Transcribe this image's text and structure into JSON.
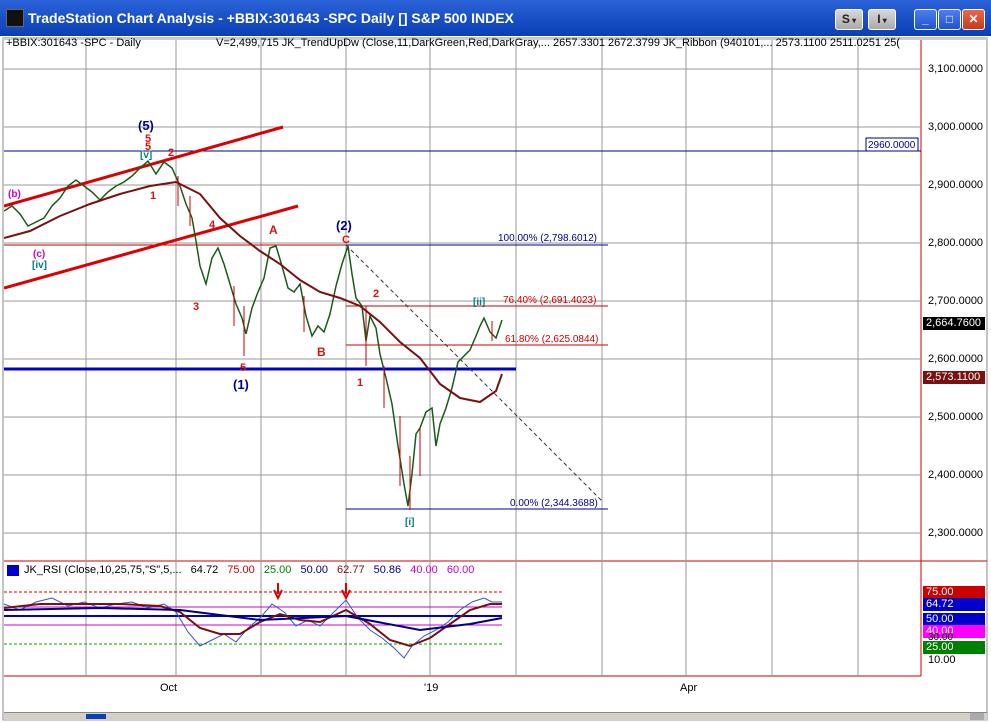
{
  "window": {
    "title": "TradeStation Chart Analysis - +BBIX:301643 -SPC Daily [] S&P 500 INDEX",
    "btn_s": "S",
    "btn_i": "I"
  },
  "header": {
    "symbol": "+BBIX:301643 -SPC - Daily",
    "indicator_line": "V=2,499,715  JK_TrendUpDw (Close,11,DarkGreen,Red,DarkGray,...   2657.3301   2672.3799  JK_Ribbon (940101,...   2573.1100   2511.0251   25("
  },
  "price_axis": {
    "ticks": [
      "3,100.0000",
      "3,000.0000",
      "2,900.0000",
      "2,800.0000",
      "2,700.0000",
      "2,600.0000",
      "2,500.0000",
      "2,400.0000",
      "2,300.0000"
    ]
  },
  "price_boxes": {
    "last": "2,664.7600",
    "ribbon": "2,573.1100"
  },
  "levels": {
    "resistance": "2960.0000"
  },
  "fib": {
    "f100": "100.00% (2,798.6012)",
    "f764": "76.40% (2,691.4023)",
    "f618": "61.80% (2,625.0844)",
    "f0": "0.00% (2,344.3688)"
  },
  "waves": {
    "w5p": "(5)",
    "w5a": "5",
    "w5b": "5",
    "wv": "[v]",
    "w2s": "2",
    "w1s": "1",
    "wb": "(b)",
    "wc": "(c)",
    "wiv": "[iv]",
    "w4": "4",
    "w3": "3",
    "w5c": "5",
    "w1p": "(1)",
    "wA": "A",
    "wB": "B",
    "w2p": "(2)",
    "wC": "C",
    "w2r": "2",
    "w1r": "1",
    "wii": "[ii]",
    "wi": "[i]"
  },
  "rsi": {
    "label": "JK_RSI (Close,10,25,75,\"S\",5,...",
    "v1": "64.72",
    "v2": "75.00",
    "v3": "25.00",
    "v4": "50.00",
    "v5": "62.77",
    "v6": "50.86",
    "v7": "40.00",
    "v8": "60.00"
  },
  "rsi_axis": {
    "b75": "75.00",
    "b6472": "64.72",
    "b50": "50.00",
    "b40": "40.00",
    "b25": "25.00",
    "t30": "30.00",
    "t10": "10.00"
  },
  "time_axis": {
    "oct": "Oct",
    "y19": "'19",
    "apr": "Apr"
  },
  "colors": {
    "bull": "#006400",
    "bear": "#cc0000",
    "ribbon": "#7a1010",
    "wave_red": "#dd1111",
    "wave_blue": "#00008b",
    "teal": "#008080",
    "magenta": "#cc00cc"
  }
}
